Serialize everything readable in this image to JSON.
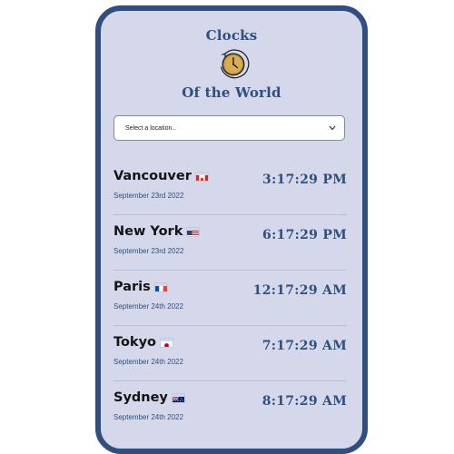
{
  "app": {
    "title_top": "Clocks",
    "title_bottom": "Of the World",
    "logo_icon": "clock-icon"
  },
  "location_select": {
    "selected_label": "Select a location..",
    "icon": "chevron-down-icon"
  },
  "colors": {
    "accent": "#2f4f80",
    "background": "#d4d8ea",
    "divider": "#b7bcd2"
  },
  "clocks": [
    {
      "city": "Vancouver",
      "flag": "canada-flag-icon",
      "date": "September 23rd 2022",
      "time": "3:17:29 PM"
    },
    {
      "city": "New York",
      "flag": "usa-flag-icon",
      "date": "September 23rd 2022",
      "time": "6:17:29 PM"
    },
    {
      "city": "Paris",
      "flag": "france-flag-icon",
      "date": "September 24th 2022",
      "time": "12:17:29 AM"
    },
    {
      "city": "Tokyo",
      "flag": "japan-flag-icon",
      "date": "September 24th 2022",
      "time": "7:17:29 AM"
    },
    {
      "city": "Sydney",
      "flag": "australia-flag-icon",
      "date": "September 24th 2022",
      "time": "8:17:29 AM"
    }
  ]
}
